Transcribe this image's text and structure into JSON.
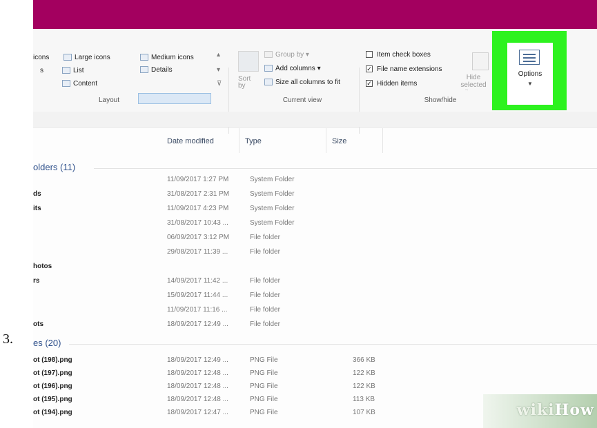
{
  "step_number": "3.",
  "ribbon": {
    "layout": {
      "large_icons_partial": "icons",
      "large_icons": "Large icons",
      "medium_icons": "Medium icons",
      "small_icons_partial": "s",
      "list": "List",
      "details": "Details",
      "content": "Content",
      "group_label": "Layout"
    },
    "current_view": {
      "sort_by": "Sort\nby",
      "group_by": "Group by",
      "add_columns": "Add columns",
      "size_all_columns": "Size all columns to fit",
      "group_label": "Current view"
    },
    "show_hide": {
      "item_check_boxes": {
        "label": "Item check boxes",
        "checked": false
      },
      "file_name_extensions": {
        "label": "File name extensions",
        "checked": true
      },
      "hidden_items": {
        "label": "Hidden items",
        "checked": true
      },
      "hide_selected": "Hide selected items",
      "group_label": "Show/hide"
    },
    "options": {
      "label": "Options",
      "highlight_color": "#2df21f"
    }
  },
  "colors": {
    "titlebar": "#a3005f",
    "group_text": "#2d4f8a"
  },
  "columns": {
    "date_modified": "Date modified",
    "type": "Type",
    "size": "Size"
  },
  "groups": {
    "folders": "olders (11)",
    "files": "es (20)"
  },
  "folder_rows": [
    {
      "name": "",
      "date": "11/09/2017 1:27 PM",
      "type": "System Folder"
    },
    {
      "name": "ds",
      "date": "31/08/2017 2:31 PM",
      "type": "System Folder"
    },
    {
      "name": "its",
      "date": "11/09/2017 4:23 PM",
      "type": "System Folder"
    },
    {
      "name": "",
      "date": "31/08/2017 10:43 ...",
      "type": "System Folder"
    },
    {
      "name": "",
      "date": "06/09/2017 3:12 PM",
      "type": "File folder"
    },
    {
      "name": "",
      "date": "29/08/2017 11:39 ...",
      "type": "File folder"
    },
    {
      "name": "hotos",
      "date": "",
      "type": ""
    },
    {
      "name": "rs",
      "date": "14/09/2017 11:42 ...",
      "type": "File folder"
    },
    {
      "name": "",
      "date": "15/09/2017 11:44 ...",
      "type": "File folder"
    },
    {
      "name": "",
      "date": "11/09/2017 11:16 ...",
      "type": "File folder"
    },
    {
      "name": "ots",
      "date": "18/09/2017 12:49 ...",
      "type": "File folder"
    }
  ],
  "file_rows": [
    {
      "name": "ot (198).png",
      "date": "18/09/2017 12:49 ...",
      "type": "PNG File",
      "size": "366 KB"
    },
    {
      "name": "ot (197).png",
      "date": "18/09/2017 12:48 ...",
      "type": "PNG File",
      "size": "122 KB"
    },
    {
      "name": "ot (196).png",
      "date": "18/09/2017 12:48 ...",
      "type": "PNG File",
      "size": "122 KB"
    },
    {
      "name": "ot (195).png",
      "date": "18/09/2017 12:48 ...",
      "type": "PNG File",
      "size": "113 KB"
    },
    {
      "name": "ot (194).png",
      "date": "18/09/2017 12:47 ...",
      "type": "PNG File",
      "size": "107 KB"
    }
  ],
  "watermark": {
    "part1": "wiki",
    "part2": "How"
  }
}
